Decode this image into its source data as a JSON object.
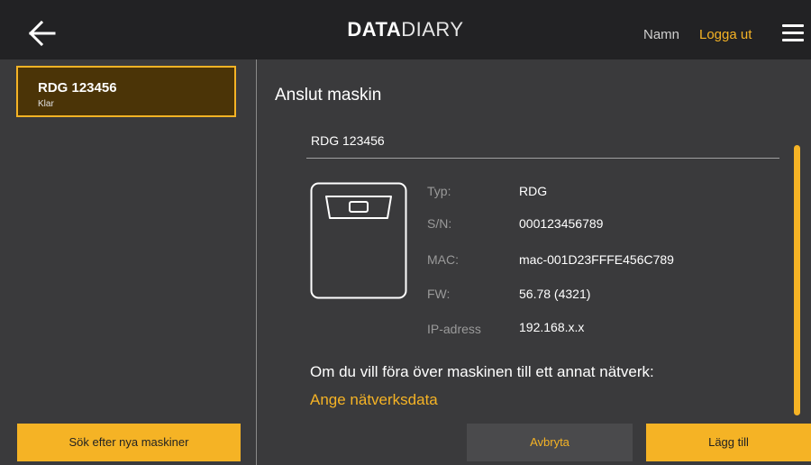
{
  "header": {
    "logo_bold": "DATA",
    "logo_light": "DIARY",
    "username": "Namn",
    "logout": "Logga ut"
  },
  "sidebar": {
    "machine": {
      "name": "RDG 123456",
      "status": "Klar"
    },
    "search_button": "Sök efter nya maskiner"
  },
  "main": {
    "title": "Anslut maskin",
    "name_value": "RDG 123456",
    "info": [
      {
        "label": "Typ:",
        "value": "RDG"
      },
      {
        "label": "S/N:",
        "value": "000123456789"
      },
      {
        "label": "MAC:",
        "value": "mac-001D23FFFE456C789"
      },
      {
        "label": "FW:",
        "value": "56.78 (4321)"
      },
      {
        "label": "IP-adress",
        "value": "192.168.x.x"
      }
    ],
    "transfer_text": "Om du vill föra över maskinen till ett annat nätverk:",
    "network_link": "Ange nätverksdata",
    "cancel": "Avbryta",
    "add": "Lägg till"
  },
  "colors": {
    "accent": "#f5b325",
    "background": "#3a3a3c",
    "topbar": "#222224",
    "selected_card": "#4b3407"
  },
  "icons": [
    "arrow-left-icon",
    "hamburger-menu-icon",
    "machine-device-icon"
  ]
}
